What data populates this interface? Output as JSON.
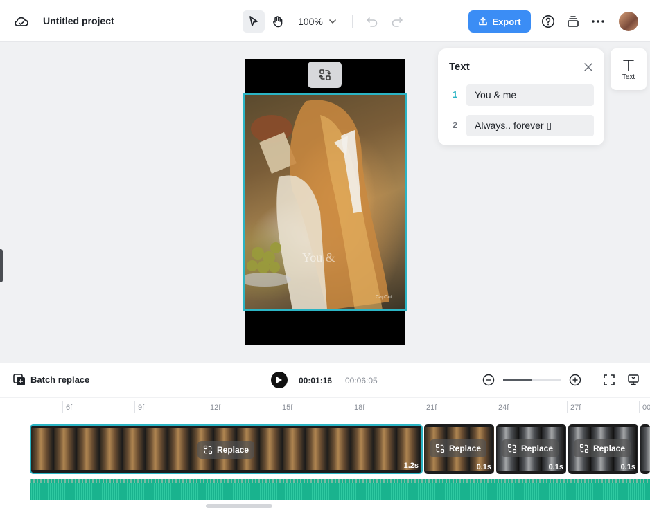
{
  "header": {
    "project_title": "Untitled project",
    "zoom": "100%",
    "export_label": "Export"
  },
  "canvas": {
    "overlay_text": "You &",
    "watermark": "CapCut"
  },
  "text_panel": {
    "title": "Text",
    "items": [
      {
        "num": "1",
        "value": "You & me"
      },
      {
        "num": "2",
        "value": "Always.. forever ▯"
      }
    ],
    "side_tab_label": "Text"
  },
  "playback": {
    "batch_replace_label": "Batch replace",
    "current_time": "00:01:16",
    "total_time": "00:06:05",
    "zoom_slider_value": 0.5
  },
  "timeline": {
    "ruler": [
      "6f",
      "9f",
      "12f",
      "15f",
      "18f",
      "21f",
      "24f",
      "27f",
      "00"
    ],
    "clips": [
      {
        "replace_label": "Replace",
        "duration": "1.2s"
      },
      {
        "replace_label": "Replace",
        "duration": "0.1s"
      },
      {
        "replace_label": "Replace",
        "duration": "0.1s"
      },
      {
        "replace_label": "Replace",
        "duration": "0.1s"
      }
    ]
  },
  "colors": {
    "accent": "#3b8df5",
    "selection": "#2bb4c4",
    "audio": "#19b38e"
  }
}
